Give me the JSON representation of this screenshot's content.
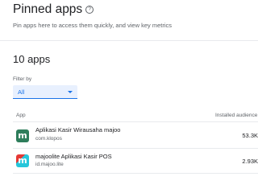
{
  "header": {
    "title": "Pinned apps",
    "help_icon": "help-circle-icon",
    "description": "Pin apps here to access them quickly, and view key metrics"
  },
  "apps_count": "10 apps",
  "filter": {
    "label": "Filter by",
    "value": "All",
    "accent": "#1a73e8"
  },
  "table": {
    "columns": {
      "app": "App",
      "installs": "Installed audience"
    },
    "rows": [
      {
        "name": "Aplikasi Kasir Wirausaha majoo",
        "package": "com.klopos",
        "installs": "53.3K",
        "icon": "majoo-app-icon"
      },
      {
        "name": "majoolite Aplikasi Kasir POS",
        "package": "id.majoo.lite",
        "installs": "2.93K",
        "icon": "majoolite-app-icon"
      }
    ]
  }
}
